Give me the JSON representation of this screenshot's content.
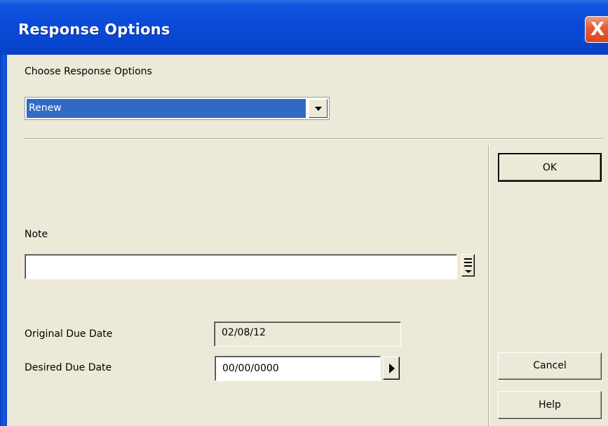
{
  "window": {
    "title": "Response Options",
    "close_glyph": "X"
  },
  "response": {
    "label": "Choose Response Options",
    "selected": "Renew"
  },
  "note": {
    "label": "Note",
    "value": ""
  },
  "dates": {
    "original_label": "Original Due Date",
    "original_value": "02/08/12",
    "desired_label": "Desired Due Date",
    "desired_value": "00/00/0000"
  },
  "buttons": {
    "ok": "OK",
    "cancel": "Cancel",
    "help": "Help"
  },
  "colors": {
    "titlebar": "#0A4AD8",
    "dialog_bg": "#ECE9D8",
    "selection": "#316AC5",
    "close": "#D8461F"
  },
  "icons": [
    "close-icon",
    "dropdown-arrow-icon",
    "note-list-icon",
    "date-arrow-icon"
  ]
}
